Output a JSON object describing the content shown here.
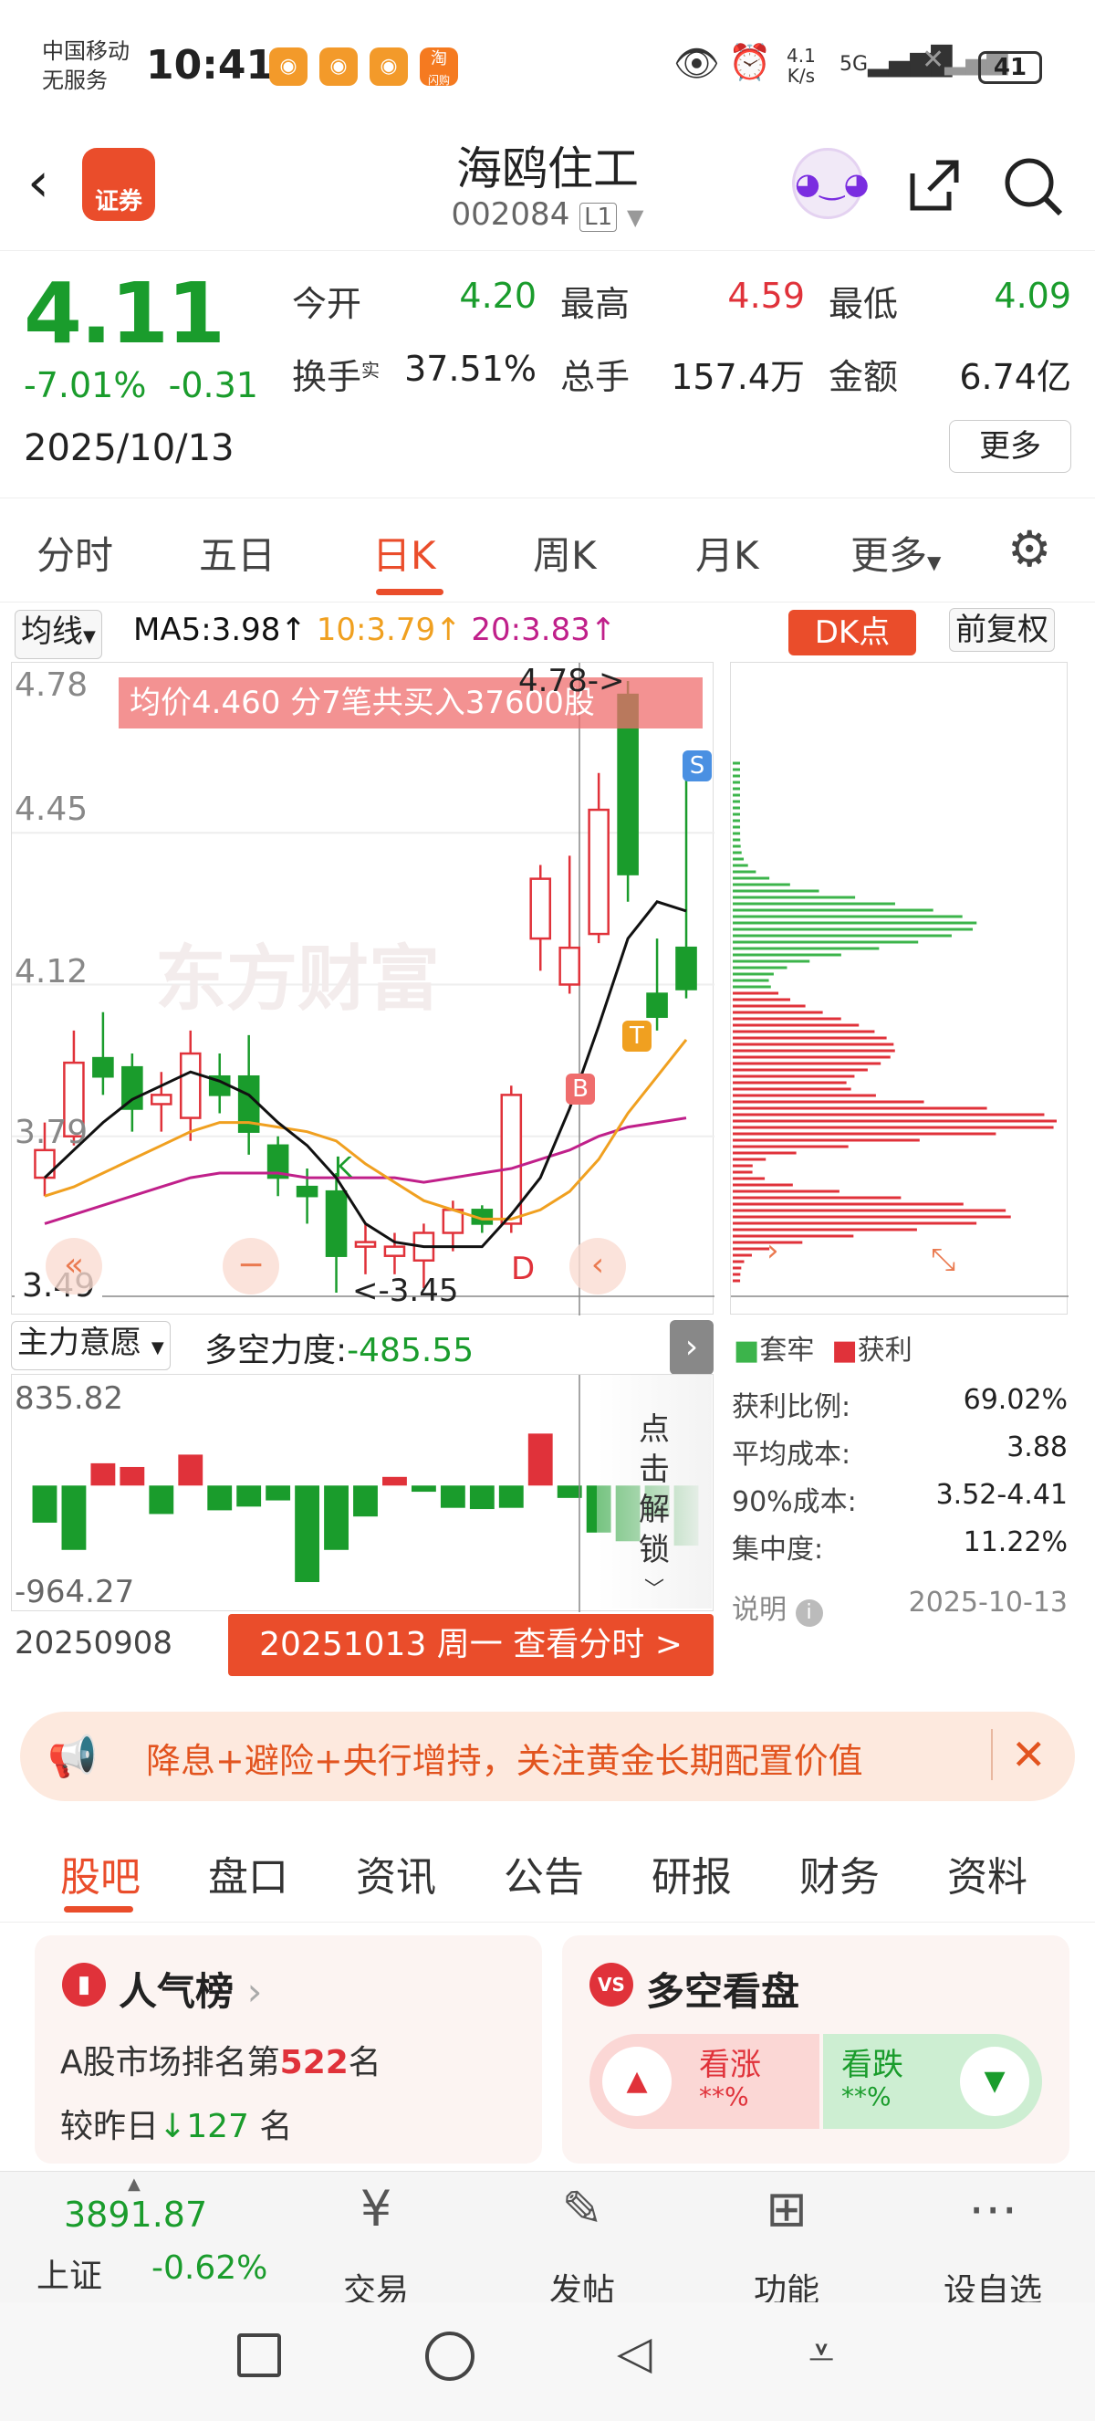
{
  "status": {
    "carrier1": "中国移动",
    "carrier2": "无服务",
    "time": "10:41",
    "netspeed_value": "4.1",
    "netspeed_unit": "K/s",
    "signal": "5G",
    "battery": "41",
    "app_icon_label": "淘",
    "app_icon_sub": "闪购"
  },
  "header": {
    "back_icon": "‹",
    "logo_text": "证券",
    "stock_name": "海鸥住工",
    "stock_code": "002084",
    "code_badge": "L1",
    "share_icon": "share-icon",
    "search_icon": "search-icon"
  },
  "quote": {
    "price": "4.11",
    "change_pct": "-7.01%",
    "change_abs": "-0.31",
    "date": "2025/10/13",
    "open_label": "今开",
    "open": "4.20",
    "high_label": "最高",
    "high": "4.59",
    "low_label": "最低",
    "low": "4.09",
    "turnover_label": "换手",
    "turnover_sup": "实",
    "turnover": "37.51%",
    "volume_label": "总手",
    "volume": "157.4万",
    "amount_label": "金额",
    "amount": "6.74亿",
    "more": "更多"
  },
  "period_tabs": [
    {
      "label": "分时"
    },
    {
      "label": "五日"
    },
    {
      "label": "日K"
    },
    {
      "label": "周K"
    },
    {
      "label": "月K"
    },
    {
      "label": "更多"
    }
  ],
  "ma": {
    "selector": "均线",
    "ma5": "MA5:3.98↑",
    "ma10": "10:3.79↑",
    "ma20": "20:3.83↑",
    "dk": "DK点",
    "adjust": "前复权",
    "colors": {
      "ma5": "#111111",
      "ma10": "#f0a020",
      "ma20": "#c0208a"
    }
  },
  "kchart": {
    "y_labels": [
      "4.78",
      "4.45",
      "4.12",
      "3.79",
      "3.49"
    ],
    "banner": "均价4.460  分7笔共买入37600股",
    "high_mark": "4.78->",
    "low_mark": "<-3.45",
    "watermark": "东方财富",
    "marker_s": "S",
    "marker_t": "T",
    "marker_b": "B",
    "marker_d": "D",
    "marker_k": "K"
  },
  "chart_data": {
    "type": "candlestick",
    "ylim": [
      3.45,
      4.78
    ],
    "candles": [
      {
        "o": 3.7,
        "c": 3.76,
        "h": 3.82,
        "l": 3.66
      },
      {
        "o": 3.79,
        "c": 3.95,
        "h": 4.02,
        "l": 3.77
      },
      {
        "o": 3.96,
        "c": 3.92,
        "h": 4.06,
        "l": 3.88
      },
      {
        "o": 3.94,
        "c": 3.85,
        "h": 3.97,
        "l": 3.8
      },
      {
        "o": 3.86,
        "c": 3.88,
        "h": 3.93,
        "l": 3.8
      },
      {
        "o": 3.83,
        "c": 3.97,
        "h": 4.02,
        "l": 3.78
      },
      {
        "o": 3.92,
        "c": 3.88,
        "h": 3.97,
        "l": 3.84
      },
      {
        "o": 3.92,
        "c": 3.8,
        "h": 4.01,
        "l": 3.75
      },
      {
        "o": 3.77,
        "c": 3.7,
        "h": 3.79,
        "l": 3.66
      },
      {
        "o": 3.68,
        "c": 3.66,
        "h": 3.72,
        "l": 3.6
      },
      {
        "o": 3.67,
        "c": 3.53,
        "h": 3.71,
        "l": 3.45
      },
      {
        "o": 3.55,
        "c": 3.56,
        "h": 3.6,
        "l": 3.49
      },
      {
        "o": 3.53,
        "c": 3.55,
        "h": 3.58,
        "l": 3.49
      },
      {
        "o": 3.52,
        "c": 3.58,
        "h": 3.6,
        "l": 3.46
      },
      {
        "o": 3.58,
        "c": 3.63,
        "h": 3.65,
        "l": 3.54
      },
      {
        "o": 3.63,
        "c": 3.6,
        "h": 3.64,
        "l": 3.58
      },
      {
        "o": 3.6,
        "c": 3.88,
        "h": 3.9,
        "l": 3.58
      },
      {
        "o": 4.22,
        "c": 4.35,
        "h": 4.38,
        "l": 4.15
      },
      {
        "o": 4.12,
        "c": 4.2,
        "h": 4.4,
        "l": 4.1
      },
      {
        "o": 4.23,
        "c": 4.5,
        "h": 4.58,
        "l": 4.21
      },
      {
        "o": 4.75,
        "c": 4.36,
        "h": 4.78,
        "l": 4.3
      },
      {
        "o": 4.1,
        "c": 4.05,
        "h": 4.22,
        "l": 4.02
      },
      {
        "o": 4.2,
        "c": 4.11,
        "h": 4.59,
        "l": 4.09
      }
    ],
    "ma5": [
      3.7,
      3.76,
      3.82,
      3.87,
      3.9,
      3.93,
      3.91,
      3.88,
      3.82,
      3.77,
      3.7,
      3.6,
      3.56,
      3.55,
      3.55,
      3.55,
      3.62,
      3.7,
      3.85,
      4.03,
      4.22,
      4.3,
      4.28
    ],
    "ma10": [
      3.66,
      3.68,
      3.71,
      3.74,
      3.77,
      3.8,
      3.82,
      3.82,
      3.81,
      3.8,
      3.78,
      3.73,
      3.69,
      3.65,
      3.63,
      3.61,
      3.61,
      3.63,
      3.67,
      3.74,
      3.84,
      3.92,
      4.0
    ],
    "ma20": [
      3.6,
      3.62,
      3.64,
      3.66,
      3.68,
      3.7,
      3.71,
      3.71,
      3.71,
      3.7,
      3.7,
      3.7,
      3.7,
      3.69,
      3.7,
      3.71,
      3.72,
      3.74,
      3.76,
      3.79,
      3.81,
      3.82,
      3.83
    ],
    "volume_ylim": [
      -964.27,
      835.82
    ],
    "volume": [
      -300,
      -520,
      180,
      150,
      -230,
      250,
      -200,
      -170,
      -120,
      -780,
      -520,
      -250,
      70,
      -50,
      -180,
      -190,
      -180,
      420,
      -100,
      -380,
      -450,
      -250,
      -485.55
    ]
  },
  "indicator": {
    "selector": "主力意愿",
    "label": "多空力度:",
    "value": "-485.55",
    "y_top": "835.82",
    "y_bottom": "-964.27",
    "side_text": [
      "点",
      "击",
      "解",
      "锁"
    ],
    "start_date": "20250908",
    "view_button": "20251013 周一 查看分时 >"
  },
  "chips": {
    "legend_loss": "套牢",
    "legend_profit": "获利",
    "stats": [
      {
        "label": "获利比例:",
        "value": "69.02%"
      },
      {
        "label": "平均成本:",
        "value": "3.88"
      },
      {
        "label": "90%成本:",
        "value": "3.52-4.41"
      },
      {
        "label": "集中度:",
        "value": "11.22%"
      },
      {
        "label": "说明",
        "value": "2025-10-13"
      }
    ]
  },
  "notice": {
    "text": "降息+避险+央行增持，关注黄金长期配置价值"
  },
  "section_tabs": [
    {
      "label": "股吧"
    },
    {
      "label": "盘口"
    },
    {
      "label": "资讯"
    },
    {
      "label": "公告"
    },
    {
      "label": "研报"
    },
    {
      "label": "财务"
    },
    {
      "label": "资料"
    }
  ],
  "popularity": {
    "title": "人气榜",
    "rank_prefix": "A股市场排名第",
    "rank": "522",
    "rank_suffix": "名",
    "change_prefix": "较昨日",
    "change": "127",
    "change_suffix": "名"
  },
  "bullbear": {
    "title": "多空看盘",
    "up_label": "看涨",
    "up_value": "**%",
    "down_label": "看跌",
    "down_value": "**%"
  },
  "bottom_nav": {
    "index_value": "3891.87",
    "index_name": "上证",
    "index_change": "-0.62%",
    "items": [
      {
        "label": "交易"
      },
      {
        "label": "发帖"
      },
      {
        "label": "功能"
      },
      {
        "label": "设自选"
      }
    ]
  }
}
